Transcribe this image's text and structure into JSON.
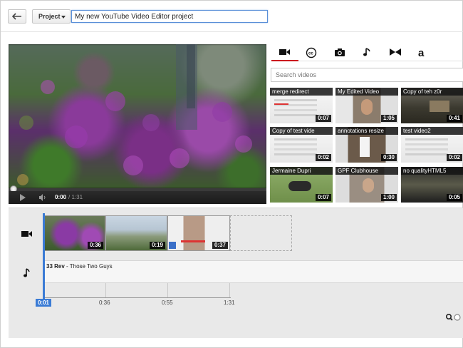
{
  "topbar": {
    "back_icon": "back-arrow-icon",
    "project_label": "Project",
    "project_title": "My new YouTube Video Editor project"
  },
  "player": {
    "current_time": "0:00",
    "total_time": "/ 1:31",
    "progress_fraction": 0.0
  },
  "tabs": [
    {
      "icon": "video-camera-icon",
      "active": true
    },
    {
      "icon": "cc-icon",
      "active": false
    },
    {
      "icon": "photo-camera-icon",
      "active": false
    },
    {
      "icon": "music-note-icon",
      "active": false
    },
    {
      "icon": "transitions-icon",
      "active": false
    },
    {
      "icon": "text-icon",
      "active": false
    }
  ],
  "search": {
    "placeholder": "Search videos"
  },
  "videos": [
    {
      "title": "merge redirect",
      "duration": "0:07"
    },
    {
      "title": "My Edited Video",
      "duration": "1:05"
    },
    {
      "title": "Copy of teh z0r",
      "duration": "0:41"
    },
    {
      "title": "Copy of test vide",
      "duration": "0:02"
    },
    {
      "title": "annotations resize",
      "duration": "0:30"
    },
    {
      "title": "test video2",
      "duration": "0:02"
    },
    {
      "title": "Jermaine Dupri",
      "duration": "0:07"
    },
    {
      "title": "GPF Clubhouse",
      "duration": "1:00"
    },
    {
      "title": "no qualityHTML5",
      "duration": "0:05"
    }
  ],
  "timeline": {
    "clips": [
      {
        "duration": "0:36"
      },
      {
        "duration": "0:19"
      },
      {
        "duration": "0:37"
      }
    ],
    "audio_track_number": "33 Rev",
    "audio_track_name": " - Those Two Guys",
    "playhead_time": "0:01",
    "ruler_labels": [
      "0:36",
      "0:55",
      "1:31"
    ]
  },
  "colors": {
    "accent": "#cc181e",
    "playhead": "#3a7bd5"
  }
}
